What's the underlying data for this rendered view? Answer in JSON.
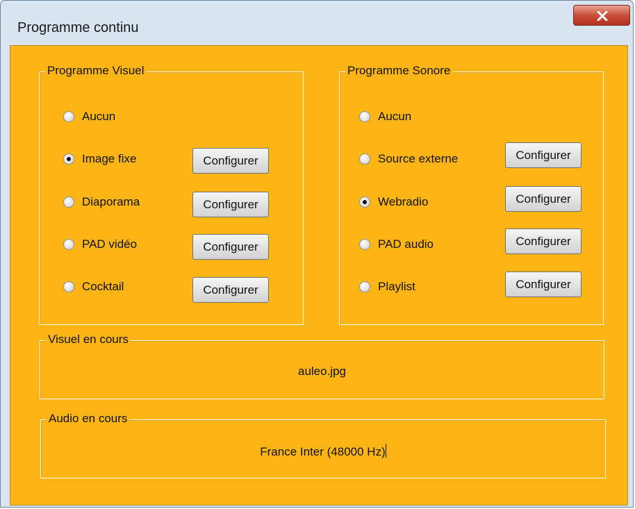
{
  "window": {
    "title": "Programme continu"
  },
  "visual_group": {
    "label": "Programme Visuel",
    "options": [
      {
        "label": "Aucun",
        "checked": false,
        "has_config": false
      },
      {
        "label": "Image fixe",
        "checked": true,
        "has_config": true
      },
      {
        "label": "Diaporama",
        "checked": false,
        "has_config": true
      },
      {
        "label": "PAD vidéo",
        "checked": false,
        "has_config": true
      },
      {
        "label": "Cocktail",
        "checked": false,
        "has_config": true
      }
    ],
    "config_label": "Configurer"
  },
  "audio_group": {
    "label": "Programme Sonore",
    "options": [
      {
        "label": "Aucun",
        "checked": false,
        "has_config": false
      },
      {
        "label": "Source externe",
        "checked": false,
        "has_config": true
      },
      {
        "label": "Webradio",
        "checked": true,
        "has_config": true
      },
      {
        "label": "PAD audio",
        "checked": false,
        "has_config": true
      },
      {
        "label": "Playlist",
        "checked": false,
        "has_config": true
      }
    ],
    "config_label": "Configurer"
  },
  "current_visual": {
    "label": "Visuel en cours",
    "value": "auleo.jpg"
  },
  "current_audio": {
    "label": "Audio en cours",
    "value": "France Inter (48000 Hz)"
  },
  "colors": {
    "background": "#fdb515",
    "window_frame": "#d9e4f1",
    "close_button": "#c7503b"
  }
}
